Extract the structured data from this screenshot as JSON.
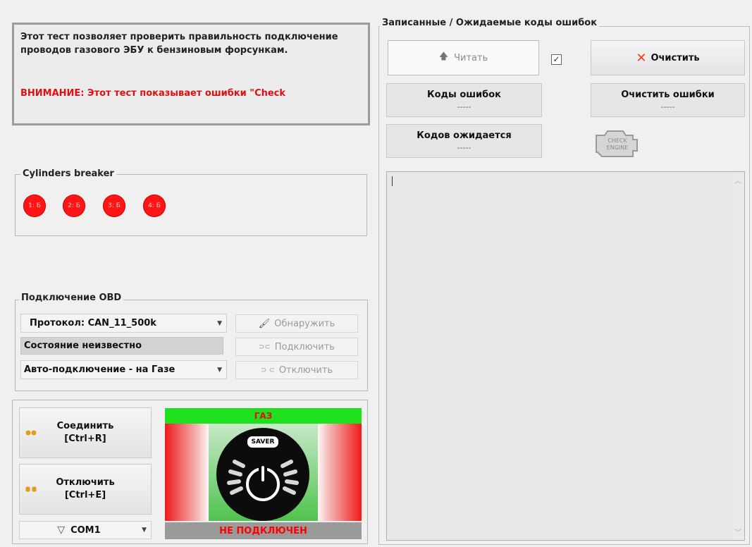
{
  "info": {
    "description": "Этот тест позволяет проверить правильность подключение проводов газового ЭБУ к бензиновым форсункам.",
    "warning": "ВНИМАНИЕ: Этот тест показывает ошибки \"Check"
  },
  "cylinders": {
    "title": "Cylinders breaker",
    "items": [
      "1: Б",
      "2: Б",
      "3: Б",
      "4: Б"
    ],
    "color": "#ff1515"
  },
  "obd": {
    "title": "Подключение OBD",
    "protocol": "Протокол: CAN_11_500k",
    "state": "Состояние неизвестно",
    "auto_connect": "Авто-подключение - на Газе",
    "detect_label": "Обнаружить",
    "connect_label": "Подключить",
    "disconnect_label": "Отключить"
  },
  "connection": {
    "connect_label": "Соединить",
    "connect_shortcut": "[Ctrl+R]",
    "disconnect_label": "Отключить",
    "disconnect_shortcut": "[Ctrl+E]",
    "port": "COM1"
  },
  "status": {
    "fuel": "ГАЗ",
    "brand": "SAVER",
    "connection": "НЕ ПОДКЛЮЧЕН",
    "fuel_color": "#1ee01e",
    "status_color": "#ff0000"
  },
  "errors": {
    "title": "Записанные / Ожидаемые коды ошибок",
    "read_label": "Читать",
    "clear_label": "Очистить",
    "codes_label": "Коды ошибок",
    "codes_value": "-----",
    "clear_errors_label": "Очистить ошибки",
    "clear_errors_value": "-----",
    "expected_label": "Кодов ожидается",
    "expected_value": "-----",
    "check_engine_line1": "CHECK",
    "check_engine_line2": "ENGINE",
    "log_text": ""
  }
}
